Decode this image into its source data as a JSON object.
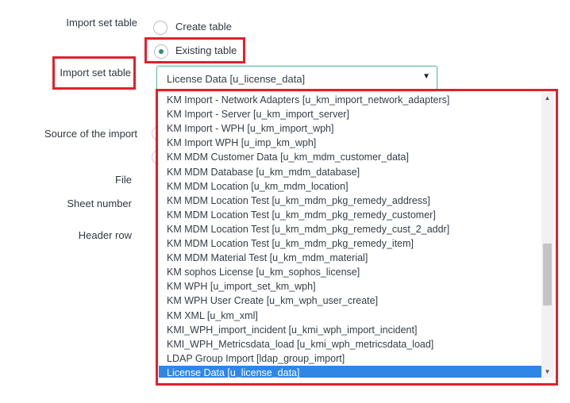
{
  "form": {
    "import_set_table_label": "Import set table",
    "create_table_label": "Create table",
    "existing_table_label": "Existing table",
    "import_set_table_label_2": "Import set table",
    "source_label": "Source of the import",
    "file_label": "File",
    "sheet_number_label": "Sheet number",
    "header_row_label": "Header row"
  },
  "radio": {
    "create_table_selected": false,
    "existing_table_selected": true
  },
  "select": {
    "value": "License Data [u_license_data]",
    "arrow": "▼"
  },
  "dropdown": {
    "items": [
      "KM Import - Network Adapters [u_km_import_network_adapters]",
      "KM Import - Server [u_km_import_server]",
      "KM Import - WPH [u_km_import_wph]",
      "KM Import WPH [u_imp_km_wph]",
      "KM MDM Customer Data [u_km_mdm_customer_data]",
      "KM MDM Database [u_km_mdm_database]",
      "KM MDM Location [u_km_mdm_location]",
      "KM MDM Location Test [u_km_mdm_pkg_remedy_address]",
      "KM MDM Location Test [u_km_mdm_pkg_remedy_customer]",
      "KM MDM Location Test [u_km_mdm_pkg_remedy_cust_2_addr]",
      "KM MDM Location Test [u_km_mdm_pkg_remedy_item]",
      "KM MDM Material Test [u_km_mdm_material]",
      "KM sophos License [u_km_sophos_license]",
      "KM WPH [u_import_set_km_wph]",
      "KM WPH User Create [u_km_wph_user_create]",
      "KM XML [u_km_xml]",
      "KMI_WPH_import_incident [u_kmi_wph_import_incident]",
      "KMI_WPH_Metricsdata_load [u_kmi_wph_metricsdata_load]",
      "LDAP Group Import [ldap_group_import]",
      "License Data [u_license_data]"
    ],
    "selected_index": 19
  },
  "scrollbar": {
    "up_icon": "▲",
    "down_icon": "▼"
  },
  "colors": {
    "highlight": "#e0212b",
    "selected_row": "#2f86e6",
    "radio_accent": "#2e8f6f"
  }
}
